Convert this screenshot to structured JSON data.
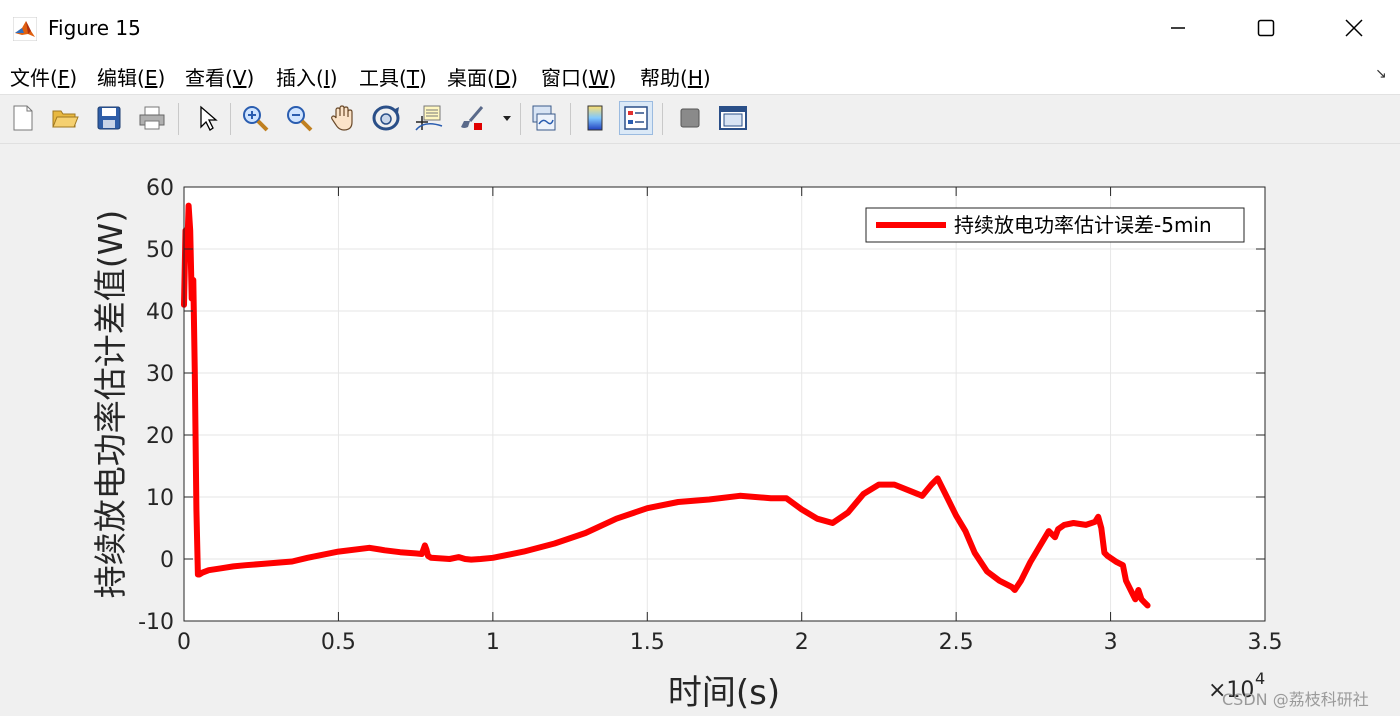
{
  "window": {
    "title": "Figure 15",
    "minimize_icon": "minimize-icon",
    "maximize_icon": "maximize-icon",
    "close_icon": "close-icon"
  },
  "menu": [
    {
      "label": "文件(",
      "key": "F",
      "tail": ")"
    },
    {
      "label": "编辑(",
      "key": "E",
      "tail": ")"
    },
    {
      "label": "查看(",
      "key": "V",
      "tail": ")"
    },
    {
      "label": "插入(",
      "key": "I",
      "tail": ")"
    },
    {
      "label": "工具(",
      "key": "T",
      "tail": ")"
    },
    {
      "label": "桌面(",
      "key": "D",
      "tail": ")"
    },
    {
      "label": "窗口(",
      "key": "W",
      "tail": ")"
    },
    {
      "label": "帮助(",
      "key": "H",
      "tail": ")"
    }
  ],
  "toolbar": {
    "icons": [
      "new-figure-icon",
      "open-file-icon",
      "save-icon",
      "print-icon",
      "select-arrow-icon",
      "zoom-in-icon",
      "zoom-out-icon",
      "pan-hand-icon",
      "rotate-3d-icon",
      "data-cursor-icon",
      "brush-icon",
      "link-plot-icon",
      "colorbar-icon",
      "legend-icon",
      "hide-plot-tools-icon",
      "show-plot-tools-icon"
    ]
  },
  "colors": {
    "series": "#ff0000",
    "grid": "#e6e6e6",
    "axis": "#262626"
  },
  "watermark": "CSDN @荔枝科研社",
  "chart_data": {
    "type": "line",
    "title": "",
    "xlabel": "时间(s)",
    "ylabel": "持续放电功率估计差值(W)",
    "xlim": [
      0,
      35000
    ],
    "ylim": [
      -10,
      60
    ],
    "x_exponent_label": "×10",
    "x_exponent_power": "4",
    "x_ticks": [
      0,
      5000,
      10000,
      15000,
      20000,
      25000,
      30000,
      35000
    ],
    "x_tick_labels": [
      "0",
      "0.5",
      "1",
      "1.5",
      "2",
      "2.5",
      "3",
      "3.5"
    ],
    "y_ticks": [
      -10,
      0,
      10,
      20,
      30,
      40,
      50,
      60
    ],
    "y_tick_labels": [
      "-10",
      "0",
      "10",
      "20",
      "30",
      "40",
      "50",
      "60"
    ],
    "grid": true,
    "legend_position": "top-right",
    "series": [
      {
        "name": "持续放电功率估计误差-5min",
        "x": [
          0,
          50,
          100,
          150,
          200,
          250,
          300,
          350,
          400,
          450,
          500,
          600,
          800,
          1200,
          1600,
          2000,
          2500,
          3000,
          3500,
          4000,
          5000,
          6000,
          6500,
          7000,
          7500,
          7700,
          7800,
          7850,
          7900,
          8000,
          8300,
          8600,
          8900,
          9100,
          9300,
          9600,
          10000,
          11000,
          12000,
          13000,
          14000,
          15000,
          16000,
          17000,
          18000,
          19000,
          19500,
          20000,
          20500,
          21000,
          21500,
          22000,
          22500,
          23000,
          23500,
          23900,
          24200,
          24400,
          24500,
          24700,
          25000,
          25300,
          25600,
          26000,
          26400,
          26800,
          26900,
          27100,
          27400,
          27700,
          28000,
          28200,
          28300,
          28500,
          28800,
          29200,
          29500,
          29600,
          29700,
          29800,
          29900,
          30200,
          30400,
          30500,
          30700,
          30800,
          30900,
          31000,
          31100,
          31200
        ],
        "y": [
          41,
          53,
          49,
          57,
          53,
          42,
          45,
          30,
          8,
          -2.5,
          -2.5,
          -2.2,
          -1.8,
          -1.5,
          -1.2,
          -1.0,
          -0.8,
          -0.6,
          -0.4,
          0.2,
          1.2,
          1.8,
          1.4,
          1.1,
          0.9,
          0.8,
          2.2,
          1.5,
          0.5,
          0.2,
          0.1,
          0.0,
          0.3,
          0.0,
          -0.1,
          0.0,
          0.2,
          1.2,
          2.5,
          4.2,
          6.5,
          8.2,
          9.2,
          9.6,
          10.2,
          9.8,
          9.8,
          8.0,
          6.5,
          5.8,
          7.5,
          10.5,
          12.0,
          12.0,
          11.0,
          10.2,
          12.0,
          13.0,
          12.0,
          10.0,
          7.0,
          4.5,
          1.0,
          -2.0,
          -3.5,
          -4.5,
          -5.0,
          -3.5,
          -0.5,
          2.0,
          4.5,
          3.5,
          4.8,
          5.5,
          5.8,
          5.5,
          6.0,
          6.8,
          5.0,
          1.0,
          0.5,
          -0.5,
          -1.0,
          -3.5,
          -5.5,
          -6.5,
          -5.0,
          -6.5,
          -7.0,
          -7.5
        ]
      }
    ]
  }
}
